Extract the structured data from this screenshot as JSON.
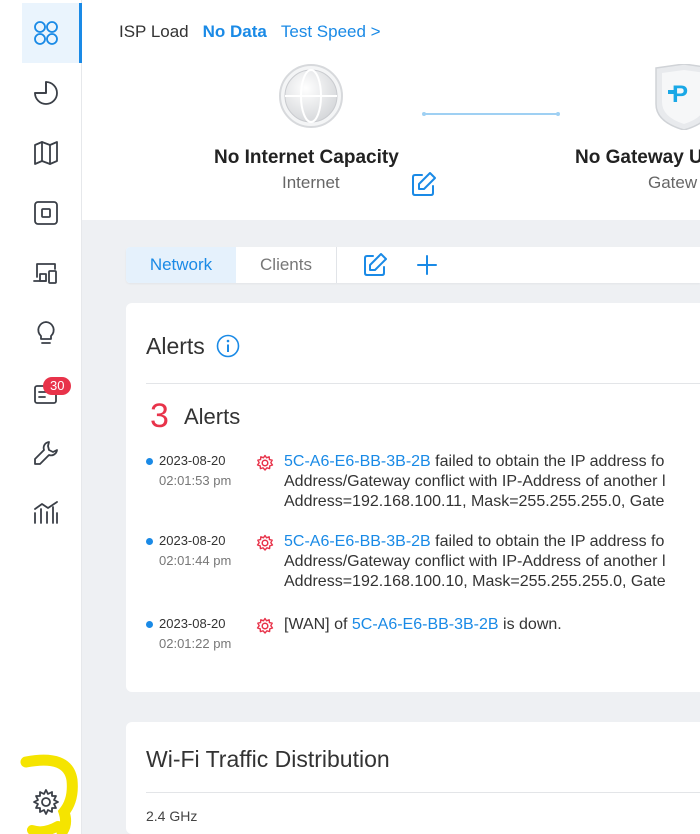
{
  "sidebar": {
    "items": [
      {
        "name": "dashboard-icon"
      },
      {
        "name": "statistics-icon"
      },
      {
        "name": "map-icon"
      },
      {
        "name": "devices-icon"
      },
      {
        "name": "clients-icon"
      },
      {
        "name": "insight-icon"
      },
      {
        "name": "log-icon",
        "badge": "30"
      },
      {
        "name": "tools-icon"
      },
      {
        "name": "reports-icon"
      },
      {
        "name": "settings-icon"
      }
    ]
  },
  "isp": {
    "label": "ISP Load",
    "value": "No Data",
    "test_speed": "Test Speed >"
  },
  "topology": {
    "internet_title": "No Internet Capacity",
    "internet_sub": "Internet",
    "gateway_title": "No Gateway U",
    "gateway_sub": "Gatew"
  },
  "tabs": {
    "network": "Network",
    "clients": "Clients"
  },
  "alerts": {
    "title": "Alerts",
    "count": "3",
    "count_label": "Alerts",
    "items": [
      {
        "date": "2023-08-20",
        "time": "02:01:53 pm",
        "mac": "5C-A6-E6-BB-3B-2B",
        "line1": " failed to obtain the IP address fo",
        "line2": "Address/Gateway conflict with IP-Address of another l",
        "line3": "Address=192.168.100.11, Mask=255.255.255.0, Gate"
      },
      {
        "date": "2023-08-20",
        "time": "02:01:44 pm",
        "mac": "5C-A6-E6-BB-3B-2B",
        "line1": " failed to obtain the IP address fo",
        "line2": "Address/Gateway conflict with IP-Address of another l",
        "line3": "Address=192.168.100.10, Mask=255.255.255.0, Gate"
      },
      {
        "date": "2023-08-20",
        "time": "02:01:22 pm",
        "prefix": "[WAN] of ",
        "mac": "5C-A6-E6-BB-3B-2B",
        "suffix": " is down."
      }
    ]
  },
  "wifi": {
    "title": "Wi-Fi Traffic Distribution",
    "band": "2.4 GHz"
  },
  "colors": {
    "accent": "#1a8ae6",
    "alert": "#e8334a",
    "highlight": "#f5e400"
  }
}
